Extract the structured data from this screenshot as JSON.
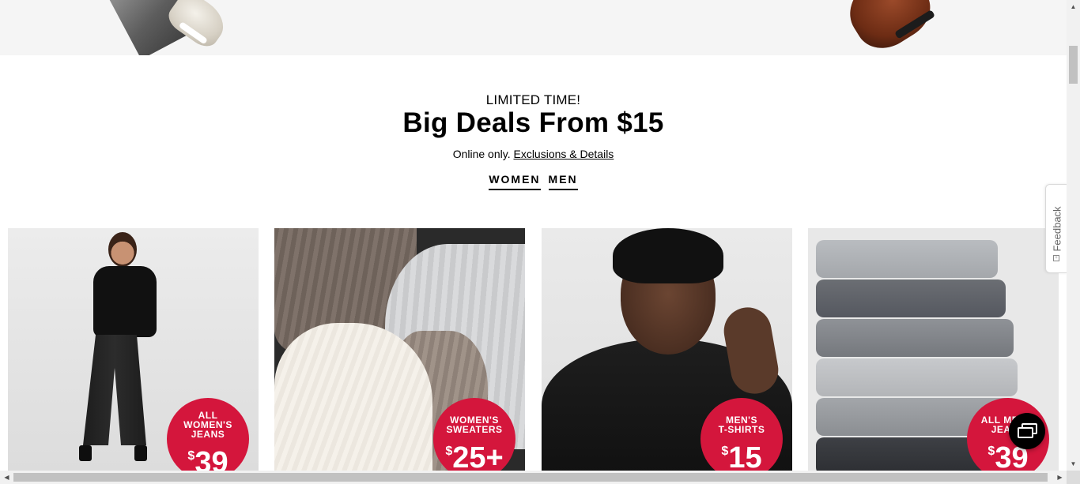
{
  "promo": {
    "eyebrow": "LIMITED TIME!",
    "headline": "Big Deals From $15",
    "sub_text": "Online only.",
    "details_link": "Exclusions & Details"
  },
  "gender_tabs": [
    {
      "label": "WOMEN"
    },
    {
      "label": "MEN"
    }
  ],
  "cards": [
    {
      "badge_line1": "ALL",
      "badge_line2": "WOMEN'S",
      "badge_line3": "JEANS",
      "currency": "$",
      "price": "39"
    },
    {
      "badge_line1": "WOMEN'S",
      "badge_line2": "SWEATERS",
      "currency": "$",
      "price": "25+"
    },
    {
      "badge_line1": "MEN'S",
      "badge_line2": "T-SHIRTS",
      "currency": "$",
      "price": "15"
    },
    {
      "badge_line1": "ALL MEN'S",
      "badge_line2": "JEANS",
      "currency": "$",
      "price": "39"
    }
  ],
  "feedback": {
    "label": "Feedback"
  },
  "colors": {
    "badge": "#d4163c",
    "text": "#000000",
    "hero_bg": "#f5f5f5"
  },
  "icons": {
    "chat": "chat-bubbles-icon",
    "feedback": "feedback-icon"
  }
}
